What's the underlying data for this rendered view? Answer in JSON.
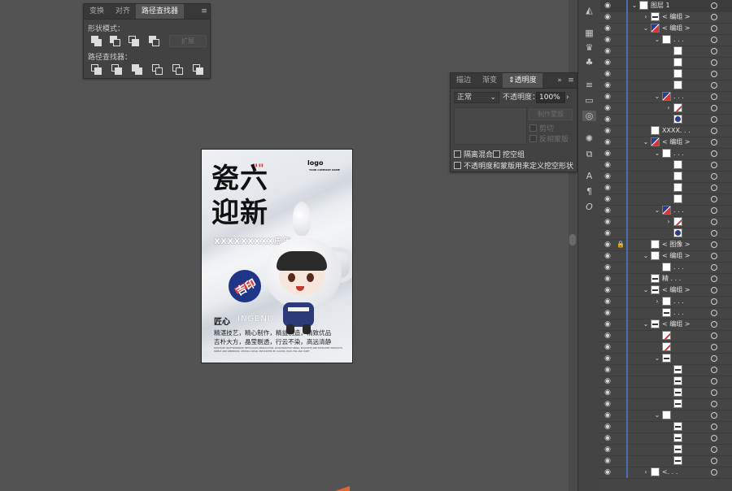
{
  "pathfinder_panel": {
    "tabs": [
      "变换",
      "对齐",
      "路径查找器"
    ],
    "active_tab": "路径查找器",
    "shape_modes_label": "形状模式：",
    "expand_label": "扩展",
    "pathfinders_label": "路径查找器："
  },
  "transparency_panel": {
    "tabs": [
      "描边",
      "渐变",
      "透明度"
    ],
    "active_tab": "透明度",
    "blend_mode": "正常",
    "opacity_label": "不透明度：",
    "opacity_value": "100%",
    "make_mask_label": "制作蒙版",
    "clip_label": "剪切",
    "invert_mask_label": "反相蒙版",
    "isolate_blending_label": "隔离混合",
    "knockout_group_label": "挖空组",
    "opacity_mask_label": "不透明度和蒙版用来定义挖空形状"
  },
  "artboard": {
    "title_line1": "瓷六",
    "title_line2": "迎新",
    "red_quote": "\"\"",
    "subtitle": "XXXXXXXXX周年",
    "logo": "logo",
    "logo_sub": "YOUR COMPANY NAME",
    "badge_text": "吉印",
    "heading_cn": "匠心",
    "heading_en": "INGENU",
    "body_line1": "精湛技艺，精心制作，精益制造，精致优品",
    "body_line2": "吉朴大方，晶莹剔透，行云不染，高远清静",
    "small_en": "EXQUISITE CRAFTSMANSHIP, METICULOUS PRODUCTION, LEAN MANUFACTURING, EXQUISITE AND EXCELLENT PRODUCTS. SIMPLE AND GENEROUS, CRYSTAL CLEAR, UNTOUCHED BY CLOUDS, HIGH, FAR AND QUIET"
  },
  "layers": [
    {
      "indent": 0,
      "arrow": "down",
      "thumb": "plain",
      "name": "图层 1",
      "selected": true
    },
    {
      "indent": 1,
      "arrow": "right",
      "thumb": "line",
      "name": "< 编组 >"
    },
    {
      "indent": 1,
      "arrow": "down",
      "thumb": "mix",
      "name": "< 编组 >"
    },
    {
      "indent": 2,
      "arrow": "down",
      "thumb": "plain",
      "name": ". . ."
    },
    {
      "indent": 3,
      "arrow": "",
      "thumb": "plain",
      "name": ""
    },
    {
      "indent": 3,
      "arrow": "",
      "thumb": "plain",
      "name": ""
    },
    {
      "indent": 3,
      "arrow": "",
      "thumb": "plain",
      "name": ""
    },
    {
      "indent": 3,
      "arrow": "",
      "thumb": "plain",
      "name": ""
    },
    {
      "indent": 2,
      "arrow": "down",
      "thumb": "mix",
      "name": ". . ."
    },
    {
      "indent": 3,
      "arrow": "right",
      "thumb": "red",
      "name": ""
    },
    {
      "indent": 3,
      "arrow": "",
      "thumb": "blue",
      "name": ""
    },
    {
      "indent": 1,
      "arrow": "",
      "thumb": "plain",
      "name": "XXXX. . ."
    },
    {
      "indent": 1,
      "arrow": "down",
      "thumb": "mix",
      "name": "< 编组 >"
    },
    {
      "indent": 2,
      "arrow": "down",
      "thumb": "plain",
      "name": ". . ."
    },
    {
      "indent": 3,
      "arrow": "",
      "thumb": "plain",
      "name": ""
    },
    {
      "indent": 3,
      "arrow": "",
      "thumb": "plain",
      "name": ""
    },
    {
      "indent": 3,
      "arrow": "",
      "thumb": "plain",
      "name": ""
    },
    {
      "indent": 3,
      "arrow": "",
      "thumb": "plain",
      "name": ""
    },
    {
      "indent": 2,
      "arrow": "down",
      "thumb": "mix",
      "name": ". . ."
    },
    {
      "indent": 3,
      "arrow": "right",
      "thumb": "red",
      "name": ""
    },
    {
      "indent": 3,
      "arrow": "",
      "thumb": "blue",
      "name": ""
    },
    {
      "indent": 1,
      "arrow": "",
      "thumb": "plain",
      "name": "< 图像 >",
      "locked": true
    },
    {
      "indent": 1,
      "arrow": "down",
      "thumb": "plain",
      "name": "< 编组 >"
    },
    {
      "indent": 2,
      "arrow": "",
      "thumb": "plain",
      "name": ". . ."
    },
    {
      "indent": 1,
      "arrow": "",
      "thumb": "line",
      "name": "精 . . ."
    },
    {
      "indent": 1,
      "arrow": "down",
      "thumb": "line",
      "name": "< 编组 >"
    },
    {
      "indent": 2,
      "arrow": "right",
      "thumb": "plain",
      "name": ". . ."
    },
    {
      "indent": 2,
      "arrow": "",
      "thumb": "line",
      "name": ". . ."
    },
    {
      "indent": 1,
      "arrow": "down",
      "thumb": "line",
      "name": "< 编组 >"
    },
    {
      "indent": 2,
      "arrow": "",
      "thumb": "red",
      "name": ""
    },
    {
      "indent": 2,
      "arrow": "",
      "thumb": "red",
      "name": ""
    },
    {
      "indent": 2,
      "arrow": "down",
      "thumb": "line",
      "name": ""
    },
    {
      "indent": 3,
      "arrow": "",
      "thumb": "line",
      "name": ""
    },
    {
      "indent": 3,
      "arrow": "",
      "thumb": "line",
      "name": ""
    },
    {
      "indent": 3,
      "arrow": "",
      "thumb": "line",
      "name": ""
    },
    {
      "indent": 3,
      "arrow": "",
      "thumb": "line",
      "name": ""
    },
    {
      "indent": 2,
      "arrow": "down",
      "thumb": "plain",
      "name": ""
    },
    {
      "indent": 3,
      "arrow": "",
      "thumb": "line",
      "name": ""
    },
    {
      "indent": 3,
      "arrow": "",
      "thumb": "line",
      "name": ""
    },
    {
      "indent": 3,
      "arrow": "",
      "thumb": "line",
      "name": ""
    },
    {
      "indent": 3,
      "arrow": "",
      "thumb": "line",
      "name": ""
    },
    {
      "indent": 1,
      "arrow": "right",
      "thumb": "plain",
      "name": "<. . ."
    }
  ],
  "toolbar_icons": [
    "color-guide-icon",
    "artboard-icon",
    "symbol-icon",
    "character-icon",
    "club-icon",
    "align-icon",
    "gradient-icon",
    "transparency-icon",
    "appearance-icon",
    "graphic-style-icon",
    "character-style-icon",
    "paragraph-icon",
    "opentype-icon"
  ]
}
